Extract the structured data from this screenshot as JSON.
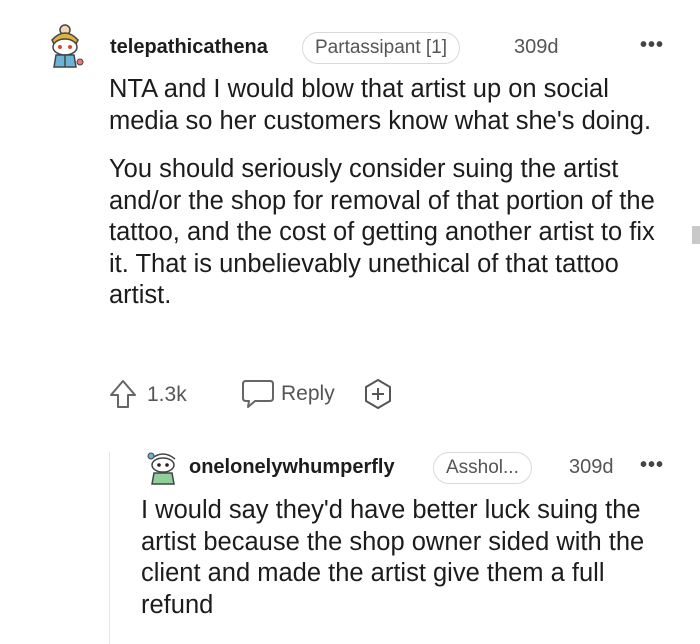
{
  "comment": {
    "username": "telepathicathena",
    "flair": "Partassipant [1]",
    "age": "309d",
    "more": "•••",
    "paragraphs": [
      "NTA and I would blow that artist up on social media so her customers know what she's doing.",
      "You should seriously consider suing the artist and/or the shop for removal of that portion of the tattoo, and the cost of getting another artist to fix it. That is unbelievably unethical of that tattoo artist."
    ],
    "actions": {
      "votes": "1.3k",
      "reply_label": "Reply"
    }
  },
  "reply": {
    "username": "onelonelywhumperfly",
    "flair": "Asshol...",
    "age": "309d",
    "more": "•••",
    "paragraphs": [
      "I would say they'd have better luck suing the artist because the shop owner sided with the client and made the artist give them a full refund"
    ]
  },
  "colors": {
    "text": "#1c1c1c",
    "muted": "#555555",
    "border": "#d9d9d9",
    "thread_line": "#e6e6e6"
  },
  "icons": {
    "upvote": "arrow-up-outline",
    "reply": "speech-bubble",
    "award": "plus-badge",
    "more": "ellipsis"
  }
}
